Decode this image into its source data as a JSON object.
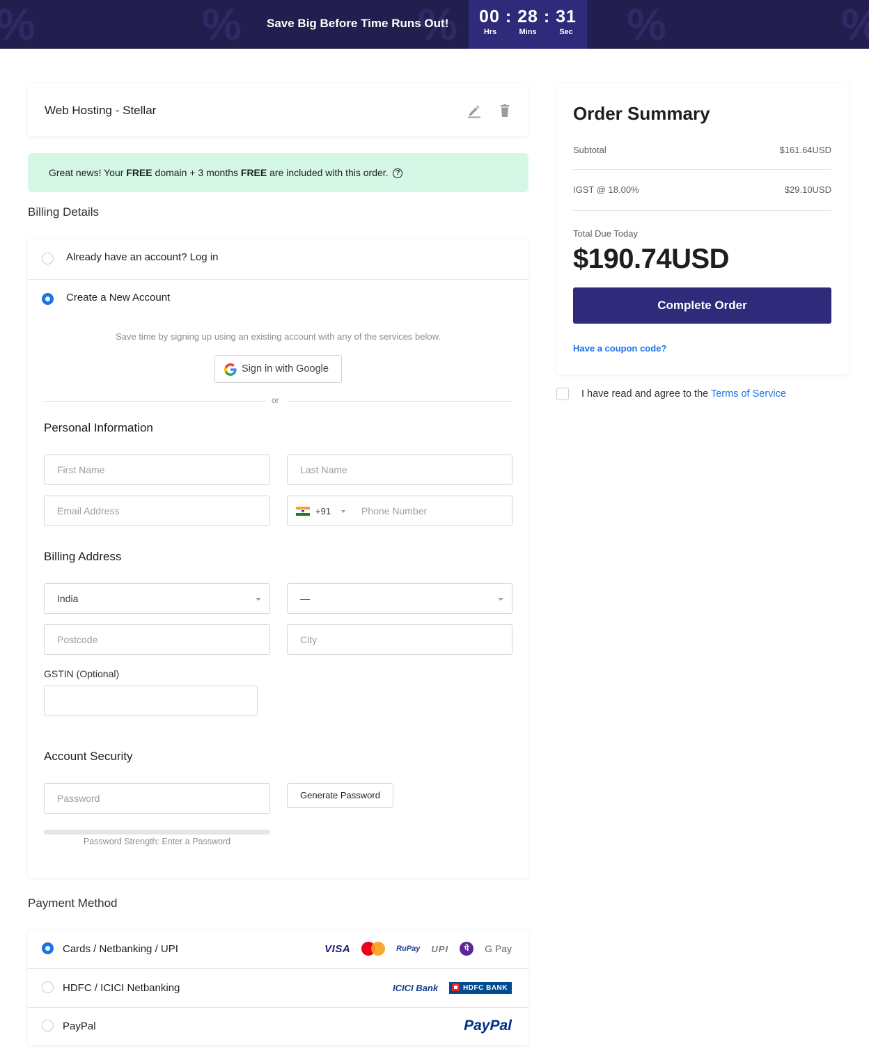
{
  "banner": {
    "headline": "Save Big Before Time Runs Out!",
    "timer": {
      "hours": "00",
      "minutes": "28",
      "seconds": "31",
      "sep": ":",
      "hours_label": "Hrs",
      "minutes_label": "Mins",
      "seconds_label": "Sec"
    }
  },
  "cart": {
    "product_name": "Web Hosting - Stellar",
    "edit_icon": "edit-icon",
    "delete_icon": "trash-icon"
  },
  "notice": {
    "prefix": "Great news! Your ",
    "free1": "FREE",
    "middle": " domain + 3 months ",
    "free2": "FREE",
    "suffix": " are included with this order."
  },
  "billing": {
    "section_title": "Billing Details",
    "login_option": "Already have an account? Log in",
    "create_option": "Create a New Account",
    "signup_helper": "Save time by signing up using an existing account with any of the services below.",
    "google_button": "Sign in with Google",
    "or_text": "or",
    "personal_title": "Personal Information",
    "first_name_placeholder": "First Name",
    "last_name_placeholder": "Last Name",
    "email_placeholder": "Email Address",
    "dial_code": "+91",
    "phone_placeholder": "Phone Number",
    "address_title": "Billing Address",
    "country_value": "India",
    "state_value": "—",
    "postcode_placeholder": "Postcode",
    "city_placeholder": "City",
    "gstin_label": "GSTIN (Optional)",
    "security_title": "Account Security",
    "password_placeholder": "Password",
    "generate_button": "Generate Password",
    "strength_text": "Password Strength: Enter a Password"
  },
  "payment": {
    "section_title": "Payment Method",
    "options": [
      {
        "label": "Cards / Netbanking / UPI",
        "logos": [
          "VISA",
          "MasterCard",
          "RuPay",
          "UPI",
          "पे",
          "G Pay"
        ]
      },
      {
        "label": "HDFC / ICICI Netbanking",
        "logos": [
          "ICICI Bank",
          "HDFC BANK"
        ]
      },
      {
        "label": "PayPal",
        "logos": [
          "PayPal"
        ]
      }
    ]
  },
  "summary": {
    "title": "Order Summary",
    "subtotal_label": "Subtotal",
    "subtotal_value": "$161.64USD",
    "tax_label": "IGST @ 18.00%",
    "tax_value": "$29.10USD",
    "due_label": "Total Due Today",
    "due_amount": "$190.74USD",
    "complete_button": "Complete Order",
    "coupon_link": "Have a coupon code?"
  },
  "tos": {
    "text": "I have read and agree to the ",
    "link": "Terms of Service"
  },
  "colors": {
    "banner_bg": "#221e4d",
    "accent": "#2f2a7a",
    "link": "#1a73e8",
    "notice_bg": "#d5f7e6"
  }
}
